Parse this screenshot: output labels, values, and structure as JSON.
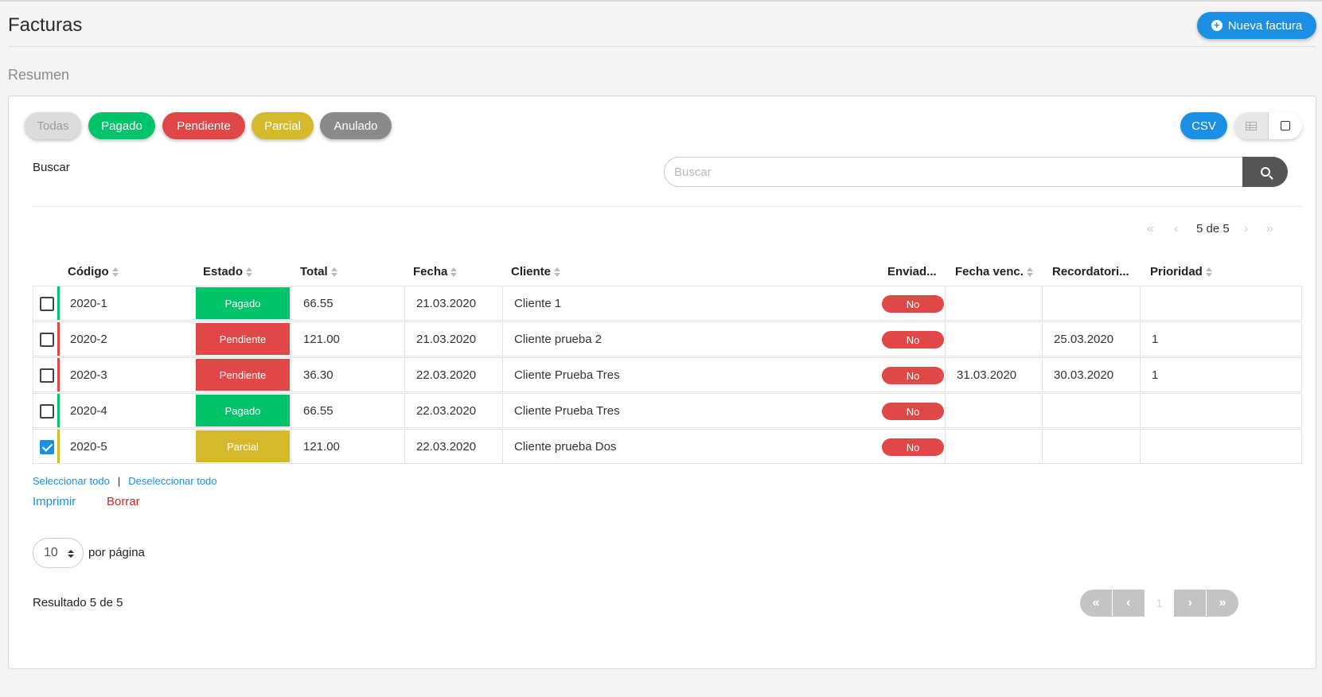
{
  "header": {
    "title": "Facturas",
    "new_button": "Nueva factura",
    "subtitle": "Resumen"
  },
  "filters": [
    "Todas",
    "Pagado",
    "Pendiente",
    "Parcial",
    "Anulado"
  ],
  "toolbar": {
    "csv": "CSV"
  },
  "search": {
    "label": "Buscar",
    "placeholder": "Buscar"
  },
  "top_pager": {
    "text": "5 de 5"
  },
  "columns": [
    "Código",
    "Estado",
    "Total",
    "Fecha",
    "Cliente",
    "Enviad...",
    "Fecha venc.",
    "Recordatori...",
    "Prioridad"
  ],
  "rows": [
    {
      "code": "2020-1",
      "state": "Pagado",
      "total": "66.55",
      "date": "21.03.2020",
      "client": "Cliente 1",
      "sent": "No",
      "due": "",
      "reminder": "",
      "priority": "",
      "checked": false
    },
    {
      "code": "2020-2",
      "state": "Pendiente",
      "total": "121.00",
      "date": "21.03.2020",
      "client": "Cliente prueba 2",
      "sent": "No",
      "due": "",
      "reminder": "25.03.2020",
      "priority": "1",
      "checked": false
    },
    {
      "code": "2020-3",
      "state": "Pendiente",
      "total": "36.30",
      "date": "22.03.2020",
      "client": "Cliente Prueba Tres",
      "sent": "No",
      "due": "31.03.2020",
      "reminder": "30.03.2020",
      "priority": "1",
      "checked": false
    },
    {
      "code": "2020-4",
      "state": "Pagado",
      "total": "66.55",
      "date": "22.03.2020",
      "client": "Cliente Prueba Tres",
      "sent": "No",
      "due": "",
      "reminder": "",
      "priority": "",
      "checked": false
    },
    {
      "code": "2020-5",
      "state": "Parcial",
      "total": "121.00",
      "date": "22.03.2020",
      "client": "Cliente prueba Dos",
      "sent": "No",
      "due": "",
      "reminder": "",
      "priority": "",
      "checked": true
    }
  ],
  "colors": {
    "Pagado": "#00c46a",
    "Pendiente": "#e04848",
    "Parcial": "#d4b92a",
    "Anulado": "#8a8a8a",
    "accent": "#1a8fe3"
  },
  "selection": {
    "select_all": "Seleccionar todo",
    "separator": "|",
    "deselect_all": "Deseleccionar todo"
  },
  "actions": {
    "print": "Imprimir",
    "delete": "Borrar"
  },
  "per_page": {
    "value": "10",
    "label": "por página"
  },
  "result": {
    "text": "Resultado 5 de 5"
  },
  "pagination": {
    "current": "1"
  }
}
